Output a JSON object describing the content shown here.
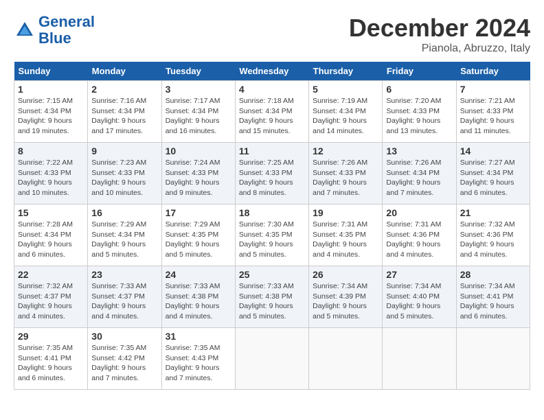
{
  "header": {
    "logo_general": "General",
    "logo_blue": "Blue",
    "month": "December 2024",
    "location": "Pianola, Abruzzo, Italy"
  },
  "weekdays": [
    "Sunday",
    "Monday",
    "Tuesday",
    "Wednesday",
    "Thursday",
    "Friday",
    "Saturday"
  ],
  "weeks": [
    [
      {
        "day": "1",
        "info": "Sunrise: 7:15 AM\nSunset: 4:34 PM\nDaylight: 9 hours\nand 19 minutes."
      },
      {
        "day": "2",
        "info": "Sunrise: 7:16 AM\nSunset: 4:34 PM\nDaylight: 9 hours\nand 17 minutes."
      },
      {
        "day": "3",
        "info": "Sunrise: 7:17 AM\nSunset: 4:34 PM\nDaylight: 9 hours\nand 16 minutes."
      },
      {
        "day": "4",
        "info": "Sunrise: 7:18 AM\nSunset: 4:34 PM\nDaylight: 9 hours\nand 15 minutes."
      },
      {
        "day": "5",
        "info": "Sunrise: 7:19 AM\nSunset: 4:34 PM\nDaylight: 9 hours\nand 14 minutes."
      },
      {
        "day": "6",
        "info": "Sunrise: 7:20 AM\nSunset: 4:33 PM\nDaylight: 9 hours\nand 13 minutes."
      },
      {
        "day": "7",
        "info": "Sunrise: 7:21 AM\nSunset: 4:33 PM\nDaylight: 9 hours\nand 11 minutes."
      }
    ],
    [
      {
        "day": "8",
        "info": "Sunrise: 7:22 AM\nSunset: 4:33 PM\nDaylight: 9 hours\nand 10 minutes."
      },
      {
        "day": "9",
        "info": "Sunrise: 7:23 AM\nSunset: 4:33 PM\nDaylight: 9 hours\nand 10 minutes."
      },
      {
        "day": "10",
        "info": "Sunrise: 7:24 AM\nSunset: 4:33 PM\nDaylight: 9 hours\nand 9 minutes."
      },
      {
        "day": "11",
        "info": "Sunrise: 7:25 AM\nSunset: 4:33 PM\nDaylight: 9 hours\nand 8 minutes."
      },
      {
        "day": "12",
        "info": "Sunrise: 7:26 AM\nSunset: 4:33 PM\nDaylight: 9 hours\nand 7 minutes."
      },
      {
        "day": "13",
        "info": "Sunrise: 7:26 AM\nSunset: 4:34 PM\nDaylight: 9 hours\nand 7 minutes."
      },
      {
        "day": "14",
        "info": "Sunrise: 7:27 AM\nSunset: 4:34 PM\nDaylight: 9 hours\nand 6 minutes."
      }
    ],
    [
      {
        "day": "15",
        "info": "Sunrise: 7:28 AM\nSunset: 4:34 PM\nDaylight: 9 hours\nand 6 minutes."
      },
      {
        "day": "16",
        "info": "Sunrise: 7:29 AM\nSunset: 4:34 PM\nDaylight: 9 hours\nand 5 minutes."
      },
      {
        "day": "17",
        "info": "Sunrise: 7:29 AM\nSunset: 4:35 PM\nDaylight: 9 hours\nand 5 minutes."
      },
      {
        "day": "18",
        "info": "Sunrise: 7:30 AM\nSunset: 4:35 PM\nDaylight: 9 hours\nand 5 minutes."
      },
      {
        "day": "19",
        "info": "Sunrise: 7:31 AM\nSunset: 4:35 PM\nDaylight: 9 hours\nand 4 minutes."
      },
      {
        "day": "20",
        "info": "Sunrise: 7:31 AM\nSunset: 4:36 PM\nDaylight: 9 hours\nand 4 minutes."
      },
      {
        "day": "21",
        "info": "Sunrise: 7:32 AM\nSunset: 4:36 PM\nDaylight: 9 hours\nand 4 minutes."
      }
    ],
    [
      {
        "day": "22",
        "info": "Sunrise: 7:32 AM\nSunset: 4:37 PM\nDaylight: 9 hours\nand 4 minutes."
      },
      {
        "day": "23",
        "info": "Sunrise: 7:33 AM\nSunset: 4:37 PM\nDaylight: 9 hours\nand 4 minutes."
      },
      {
        "day": "24",
        "info": "Sunrise: 7:33 AM\nSunset: 4:38 PM\nDaylight: 9 hours\nand 4 minutes."
      },
      {
        "day": "25",
        "info": "Sunrise: 7:33 AM\nSunset: 4:38 PM\nDaylight: 9 hours\nand 5 minutes."
      },
      {
        "day": "26",
        "info": "Sunrise: 7:34 AM\nSunset: 4:39 PM\nDaylight: 9 hours\nand 5 minutes."
      },
      {
        "day": "27",
        "info": "Sunrise: 7:34 AM\nSunset: 4:40 PM\nDaylight: 9 hours\nand 5 minutes."
      },
      {
        "day": "28",
        "info": "Sunrise: 7:34 AM\nSunset: 4:41 PM\nDaylight: 9 hours\nand 6 minutes."
      }
    ],
    [
      {
        "day": "29",
        "info": "Sunrise: 7:35 AM\nSunset: 4:41 PM\nDaylight: 9 hours\nand 6 minutes."
      },
      {
        "day": "30",
        "info": "Sunrise: 7:35 AM\nSunset: 4:42 PM\nDaylight: 9 hours\nand 7 minutes."
      },
      {
        "day": "31",
        "info": "Sunrise: 7:35 AM\nSunset: 4:43 PM\nDaylight: 9 hours\nand 7 minutes."
      },
      null,
      null,
      null,
      null
    ]
  ]
}
